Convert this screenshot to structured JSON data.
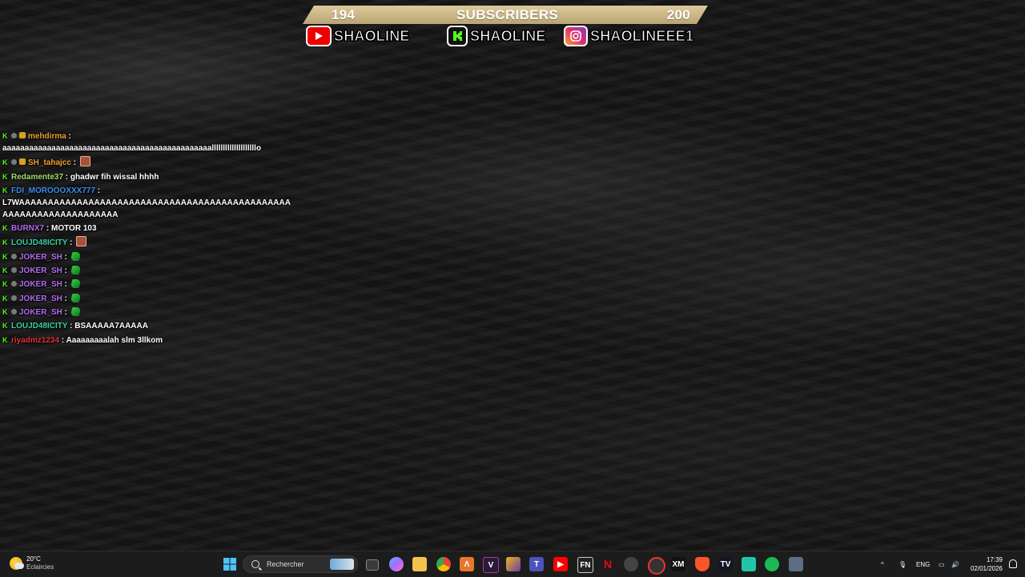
{
  "overlay": {
    "subscribers": {
      "current": "194",
      "label": "SUBSCRIBERS",
      "goal": "200"
    },
    "socials": [
      {
        "platform": "youtube-icon",
        "handle": "SHAOLINE"
      },
      {
        "platform": "kick-icon",
        "handle": "SHAOLINE"
      },
      {
        "platform": "instagram-icon",
        "handle": "SHAOLINEEE1"
      }
    ]
  },
  "chat": {
    "messages": [
      {
        "user": "mehdirma",
        "color": "#f0a030",
        "text": "aaaaaaaaaaaaaaaaaaaaaaaaaaaaaaaaaaaaaaaaaaaaaaallllllllllllllllllllo"
      },
      {
        "user": "SH_tahajcc",
        "color": "#f0a030",
        "text": ""
      },
      {
        "user": "Redamente37",
        "color": "#9ee06a",
        "text": "ghadwr fih wissal hhhh"
      },
      {
        "user": "FDI_MOROOOXXX777",
        "color": "#3c8cf0",
        "text": "L7WAAAAAAAAAAAAAAAAAAAAAAAAAAAAAAAAAAAAAAAAAAAAAAAAAAAAAAAAAAAAAAAAAAA"
      },
      {
        "user": "BURNX7",
        "color": "#b36bf0",
        "text": "MOTOR 103"
      },
      {
        "user": "LOUJD48ICITY",
        "color": "#3ad0a0",
        "text": ""
      },
      {
        "user": "JOKER_SH",
        "color": "#b36bf0",
        "text": ""
      },
      {
        "user": "JOKER_SH",
        "color": "#b36bf0",
        "text": ""
      },
      {
        "user": "JOKER_SH",
        "color": "#b36bf0",
        "text": ""
      },
      {
        "user": "JOKER_SH",
        "color": "#b36bf0",
        "text": ""
      },
      {
        "user": "JOKER_SH",
        "color": "#b36bf0",
        "text": ""
      },
      {
        "user": "LOUJD48ICITY",
        "color": "#3ad0a0",
        "text": "BSAAAAA7AAAAA"
      },
      {
        "user": "riyadmz1234",
        "color": "#e0303c",
        "text": "Aaaaaaaaalah slm 3llkom"
      }
    ]
  },
  "taskbar": {
    "weather": {
      "temp": "20°C",
      "condition": "Eclaircies"
    },
    "search_placeholder": "Rechercher",
    "language": "ENG",
    "time": "17:39",
    "date": "02/01/2026"
  }
}
